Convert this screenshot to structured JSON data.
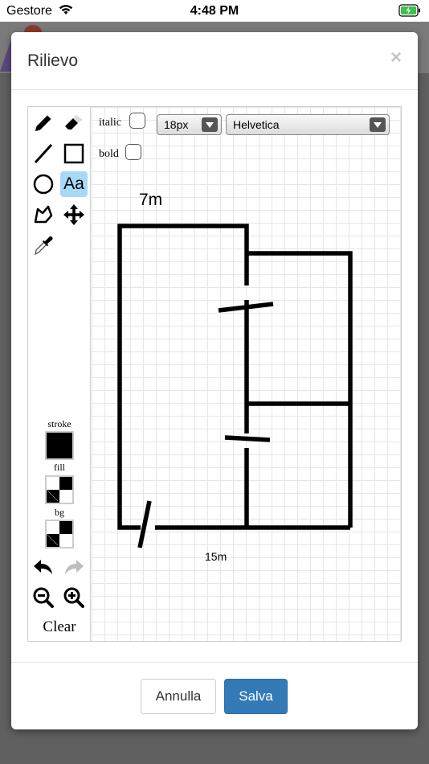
{
  "status_bar": {
    "carrier": "Gestore",
    "time": "4:48 PM"
  },
  "modal": {
    "title": "Rilievo",
    "close_symbol": "×",
    "cancel_label": "Annulla",
    "save_label": "Salva",
    "save_color": "#337ab7"
  },
  "toolbar": {
    "tools": [
      {
        "name": "pencil-icon"
      },
      {
        "name": "eraser-icon"
      },
      {
        "name": "line-icon"
      },
      {
        "name": "rectangle-icon"
      },
      {
        "name": "circle-icon"
      },
      {
        "name": "text-tool",
        "glyph": "Aa",
        "active": true
      },
      {
        "name": "polygon-icon"
      },
      {
        "name": "move-icon"
      },
      {
        "name": "eyedropper-icon"
      }
    ],
    "stroke_label": "stroke",
    "fill_label": "fill",
    "bg_label": "bg",
    "stroke_color": "#000000",
    "clear_label": "Clear",
    "active_tool_color": "#a8d8f8"
  },
  "text_options": {
    "italic_label": "italic",
    "bold_label": "bold",
    "font_size": "18px",
    "font_family": "Helvetica"
  },
  "drawing": {
    "labels": [
      {
        "id": "top",
        "text": "7m"
      },
      {
        "id": "bottom",
        "text": "15m"
      }
    ]
  }
}
